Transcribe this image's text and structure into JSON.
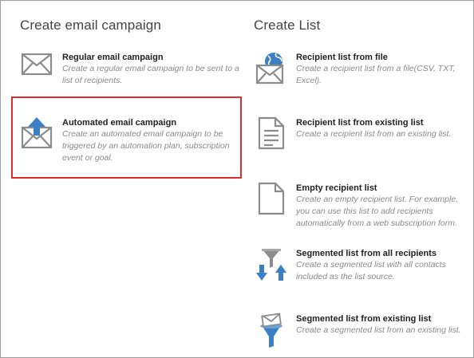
{
  "email_column": {
    "title": "Create email campaign",
    "items": [
      {
        "title": "Regular email campaign",
        "description": "Create a regular email campaign to be sent to a list of recipients.",
        "icon": "envelope-icon"
      },
      {
        "title": "Automated email campaign",
        "description": "Create an automated email campaign to be triggered by an automation plan, subscription event or goal.",
        "icon": "envelope-arrow-up-icon"
      }
    ]
  },
  "list_column": {
    "title": "Create List",
    "items": [
      {
        "title": "Recipient list from file",
        "description": "Create a recipient list from a file(CSV, TXT, Excel).",
        "icon": "globe-envelope-icon"
      },
      {
        "title": "Recipient list from existing list",
        "description": "Create a recipient list from an existing list.",
        "icon": "document-lines-icon"
      },
      {
        "title": "Empty recipient list",
        "description": "Create an empty recipient list. For example, you can use this list to add recipients automatically from a web subscription form.",
        "icon": "blank-document-icon"
      },
      {
        "title": "Segmented list from all recipients",
        "description": "Create a segmented list with all contacts included as the list source.",
        "icon": "funnel-arrows-icon"
      },
      {
        "title": "Segmented list from existing list",
        "description": "Create a segmented list from an existing list.",
        "icon": "funnel-envelope-icon"
      }
    ]
  },
  "colors": {
    "accent_blue": "#3b7fc4",
    "icon_gray": "#8c8c8c",
    "highlight_red": "#d9302f"
  }
}
